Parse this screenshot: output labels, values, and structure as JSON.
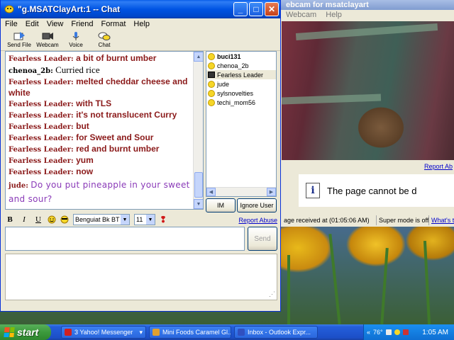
{
  "chat_window": {
    "title": "\"g.MSATClayArt:1 -- Chat",
    "menu": [
      "File",
      "Edit",
      "View",
      "Friend",
      "Format",
      "Help"
    ],
    "toolbar": [
      "Send File",
      "Webcam",
      "Voice",
      "Chat"
    ],
    "messages": [
      {
        "nick": "Fearless Leader:",
        "text": "a bit of burnt umber",
        "style": "fl"
      },
      {
        "nick": "chenoa_2b:",
        "text": "Curried rice",
        "style": "chenoa"
      },
      {
        "nick": "Fearless Leader:",
        "text": "melted cheddar cheese and white",
        "style": "fl"
      },
      {
        "nick": "Fearless Leader:",
        "text": "with TLS",
        "style": "fl"
      },
      {
        "nick": "Fearless Leader:",
        "text": "it's not translucent Curry",
        "style": "fl"
      },
      {
        "nick": "Fearless Leader:",
        "text": "but",
        "style": "fl"
      },
      {
        "nick": "Fearless Leader:",
        "text": "for Sweet and Sour",
        "style": "fl"
      },
      {
        "nick": "Fearless Leader:",
        "text": "red and burnt umber",
        "style": "fl"
      },
      {
        "nick": "Fearless Leader:",
        "text": "yum",
        "style": "fl"
      },
      {
        "nick": "Fearless Leader:",
        "text": "now",
        "style": "fl"
      },
      {
        "nick": "jude:",
        "text": "Do you put pineapple in your sweet and sour?",
        "style": "jude"
      }
    ],
    "users": [
      {
        "name": "buci131",
        "bold": true,
        "icon": "smiley-icon"
      },
      {
        "name": "chenoa_2b",
        "bold": false,
        "icon": "smiley-icon"
      },
      {
        "name": "Fearless Leader",
        "bold": false,
        "icon": "webcam-icon",
        "selected": true
      },
      {
        "name": "jude",
        "bold": false,
        "icon": "smiley-icon"
      },
      {
        "name": "sylsnovelties",
        "bold": false,
        "icon": "smiley-icon"
      },
      {
        "name": "techi_mom56",
        "bold": false,
        "icon": "smiley-icon"
      }
    ],
    "im_label": "IM",
    "ignore_label": "Ignore User",
    "format": {
      "bold": "B",
      "italic": "I",
      "underline": "U",
      "font": "Benguiat Bk BT",
      "size": "11"
    },
    "report_abuse": "Report Abuse",
    "send_label": "Send",
    "input_value": ""
  },
  "webcam_window": {
    "title": "ebcam for msatclayart",
    "menu": [
      "Webcam",
      "Help"
    ],
    "report_abuse": "Report Ab",
    "error_text": "The page cannot be d",
    "status_received": "age received at (01:05:06 AM)",
    "status_super": "Super mode is off",
    "status_link": "What's t"
  },
  "taskbar": {
    "start": "start",
    "tasks": [
      {
        "label": "3 Yahoo! Messenger",
        "icon": "yahoo-icon",
        "color": "#d02020"
      },
      {
        "label": "Mini Foods Caramel Gl...",
        "icon": "ie-icon",
        "color": "#e0a030"
      },
      {
        "label": "Inbox - Outlook Expr...",
        "icon": "outlook-icon",
        "color": "#3050c0"
      }
    ],
    "tray_temp": "76°",
    "clock": "1:05 AM"
  },
  "colors": {
    "titlebar": "#0054e3",
    "chat_red": "#8b1a1a",
    "jude_purple": "#8a3ab8",
    "start_green": "#3c9a3c"
  }
}
